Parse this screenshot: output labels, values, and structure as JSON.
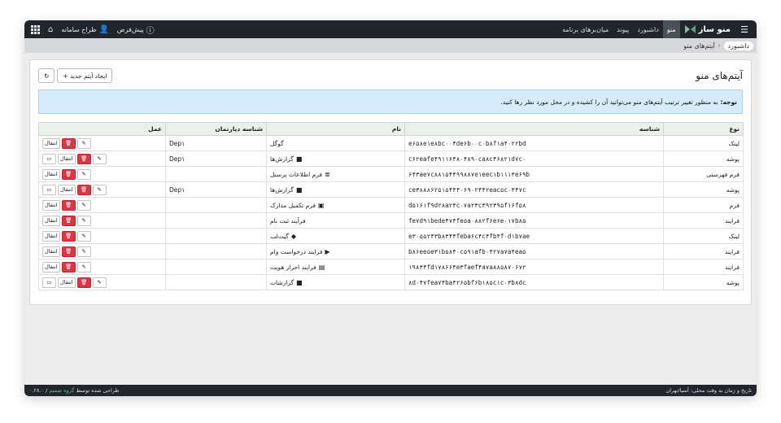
{
  "topbar": {
    "app_name": "منو ساز",
    "nav": [
      {
        "label": "منو",
        "active": true
      },
      {
        "label": "داشبورد",
        "active": false
      },
      {
        "label": "پیوند",
        "active": false
      },
      {
        "label": "میان‌برهای برنامه",
        "active": false
      }
    ],
    "default_label": "پیش‌فرض",
    "user_label": "طراح سامانه"
  },
  "breadcrumb": {
    "home": "داشبورد",
    "current": "آیتم‌های منو"
  },
  "page": {
    "title": "آیتم‌های منو",
    "new_item_button": "+ ایجاد آیتم جدید",
    "notice_bold": "توجه:",
    "notice_text": "به منظور تغییر ترتیب آیتم‌های منو می‌توانید آن را کشیده و در محل مورد نظر رها کنید."
  },
  "table": {
    "headers": {
      "type": "نوع",
      "id": "شناسه",
      "name": "نام",
      "dept": "شناسه دپارتمان",
      "action": "عمل"
    },
    "move_label": "انتقال",
    "rows": [
      {
        "type": "لینک",
        "id": "e۶۵۸e۱e۸bc۰۰۴de۶b۰۰c۰b۸f۱a۴۰۲۲bd",
        "name": "گوگل",
        "icon": "",
        "dept": "Dep۱",
        "folder": false
      },
      {
        "type": "پوشه",
        "id": "c۶۲eafe۴۹۱۱۶۴۸۰۴۸۹۰ca۸c۴۶۸۲۱d۷c۰",
        "name": "گزارش‌ها",
        "icon": "folder-icon",
        "dept": "Dep۱",
        "folder": true
      },
      {
        "type": "فرم فهرستی",
        "id": "۶۴۳ae۷c۸۸۱۵۴۴۹۹۸۸۷e۱eec۱b۱۱۱۳e۶۹b",
        "name": "فرم اطلاعات پرسنل",
        "icon": "database-icon",
        "dept": "",
        "folder": false
      },
      {
        "type": "پوشه",
        "id": "ce۳۸۸۸۶۲۵۱۵۴۴۴۰۶۹۰۲۴۴۲eac۵c۰۳۴۷c",
        "name": "گزارش‌ها",
        "icon": "folder-icon",
        "dept": "Dep۱",
        "folder": true
      },
      {
        "type": "فرم",
        "id": "d۵۱۶۱f۹d۲۸a۲۴c۰۷a۲۳c۳۹۲۳۹۵f۱۶f۵۸",
        "name": "فرم تکمیل مدارک",
        "icon": "form-icon",
        "dept": "",
        "folder": false
      },
      {
        "type": "فرایند",
        "id": "fe۷d۹۱bede۴۷۴fe۵a۰۸۸۲f۶e۶e۰۱۷b۸۵",
        "name": "فرآیند ثبت نام",
        "icon": "",
        "dept": "",
        "folder": false
      },
      {
        "type": "لینک",
        "id": "e۳۰۵۵۲۴۳b۸۳۴۴feba۶c۴c۴fb۴f۰d۱b۷ae",
        "name": "گیت‌لب",
        "icon": "gitlab-icon",
        "dept": "",
        "folder": false
      },
      {
        "type": "فرایند",
        "id": "b۸۶ee۵e۳۱b۵۸۴۰c۵۹۱afb۰۴۲۷a۷a۴ea۵",
        "name": "فرایند درخواست وام",
        "icon": "play-icon",
        "dept": "",
        "folder": false
      },
      {
        "type": "فرایند",
        "id": "۱۹۸۳۴fd۱۷۸۶۶۴e۳faef۴a۷a۸۸۵۸۷۰۶۷۲",
        "name": "فرایند احراز هویت",
        "icon": "idcard-icon",
        "dept": "",
        "folder": false
      },
      {
        "type": "پوشه",
        "id": "۸d۰۴۷fea۷۴ba۴۲۶۵bf۶b۱۸۵c۱c۰۳b۸dc",
        "name": "گزارشات",
        "icon": "folder-icon",
        "dept": "",
        "folder": true
      }
    ]
  },
  "footer": {
    "left": "تاریخ و زمان به وقت محلی: آسیا/تهران",
    "credit_prefix": "طراحی شده توسط",
    "credit_group": "گروه صمیم",
    "version": "/ ۰.۲۸.۰"
  }
}
